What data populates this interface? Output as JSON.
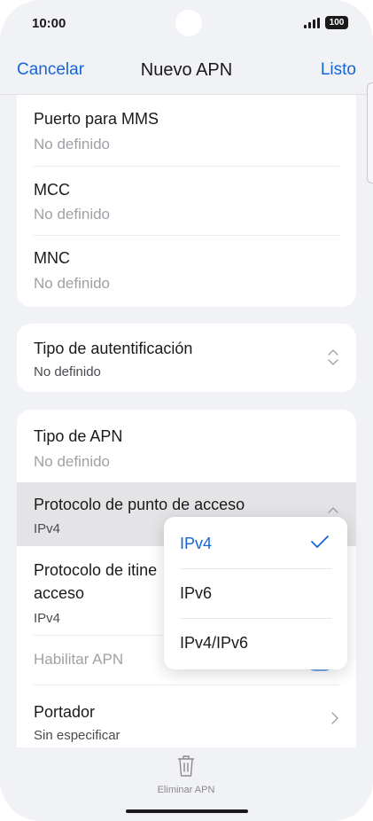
{
  "status_bar": {
    "time": "10:00",
    "battery": "100"
  },
  "nav": {
    "cancel": "Cancelar",
    "title": "Nuevo APN",
    "done": "Listo"
  },
  "card1": {
    "rows": [
      {
        "title": "Puerto para MMS",
        "value": "No definido"
      },
      {
        "title": "MCC",
        "value": "No definido"
      },
      {
        "title": "MNC",
        "value": "No definido"
      }
    ]
  },
  "auth": {
    "title": "Tipo de autentificación",
    "value": "No definido"
  },
  "card3": {
    "apn_type": {
      "title": "Tipo de APN",
      "value": "No definido"
    },
    "access_protocol": {
      "title": "Protocolo de punto de acceso",
      "value": "IPv4"
    },
    "roaming_protocol": {
      "title_line1": "Protocolo de itine",
      "title_line2": "acceso",
      "value": "IPv4"
    },
    "enable_apn": {
      "title": "Habilitar APN"
    },
    "bearer": {
      "title": "Portador",
      "value": "Sin especificar"
    }
  },
  "dropdown": {
    "options": [
      {
        "label": "IPv4",
        "selected": true
      },
      {
        "label": "IPv6",
        "selected": false
      },
      {
        "label": "IPv4/IPv6",
        "selected": false
      }
    ]
  },
  "bottom": {
    "delete_label": "Eliminar APN"
  },
  "colors": {
    "accent": "#1565d8",
    "background": "#f1f2f6",
    "card": "#ffffff"
  }
}
